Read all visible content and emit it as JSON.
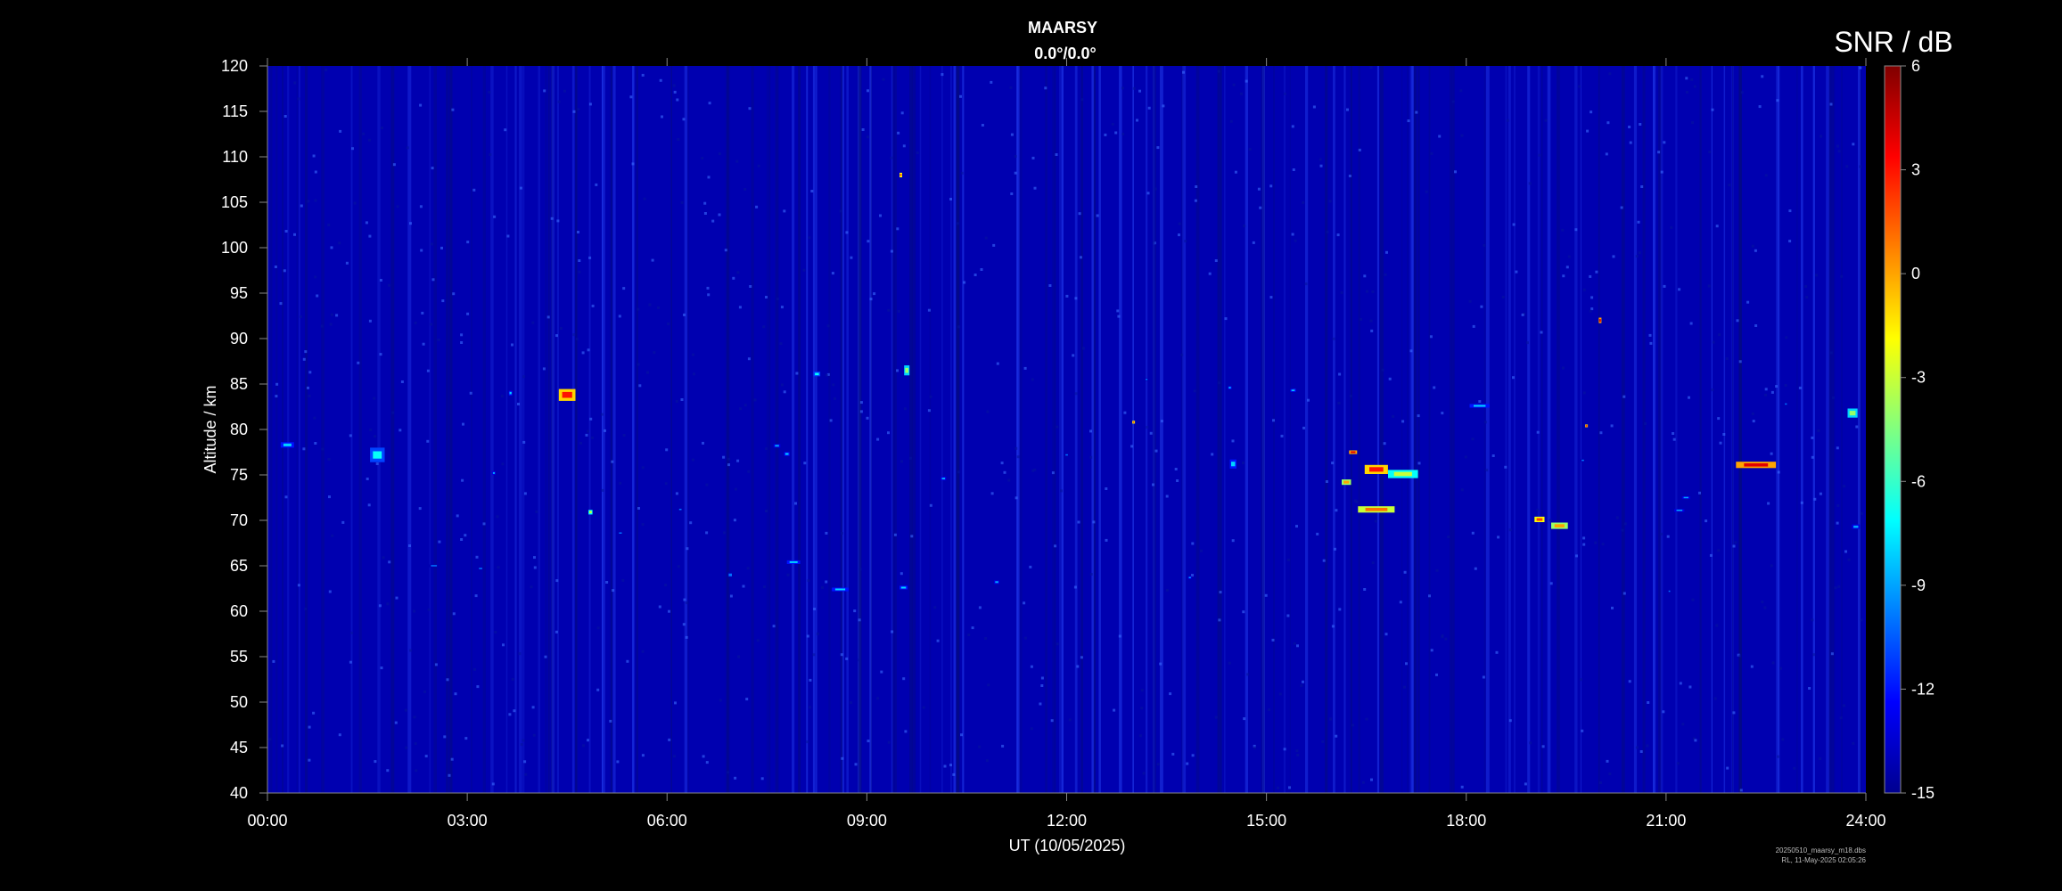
{
  "chart_data": {
    "type": "heatmap",
    "title": "MAARSY",
    "subtitle": "0.0°/0.0°",
    "xlabel": "UT (10/05/2025)",
    "ylabel": "Altitude / km",
    "x_ticks": [
      "00:00",
      "03:00",
      "06:00",
      "09:00",
      "12:00",
      "15:00",
      "18:00",
      "21:00",
      "24:00"
    ],
    "xlim_hours": [
      0,
      24
    ],
    "y_ticks": [
      40,
      45,
      50,
      55,
      60,
      65,
      70,
      75,
      80,
      85,
      90,
      95,
      100,
      105,
      110,
      115,
      120
    ],
    "ylim": [
      40,
      120
    ],
    "colorbar": {
      "title": "SNR / dB",
      "ticks": [
        6,
        3,
        0,
        -3,
        -6,
        -9,
        -12,
        -15
      ],
      "range": [
        -15,
        6
      ],
      "colormap": "jet"
    },
    "background_snr_db": -14,
    "echoes": [
      {
        "t": 0.3,
        "alt": 78.3,
        "dt": 0.2,
        "dh": 0.6,
        "snr": -8
      },
      {
        "t": 1.65,
        "alt": 77.2,
        "dt": 0.22,
        "dh": 1.6,
        "snr": -7
      },
      {
        "t": 3.65,
        "alt": 84.0,
        "dt": 0.05,
        "dh": 0.5,
        "snr": -8
      },
      {
        "t": 4.5,
        "alt": 83.8,
        "dt": 0.25,
        "dh": 1.3,
        "snr": 3
      },
      {
        "t": 4.85,
        "alt": 70.9,
        "dt": 0.06,
        "dh": 0.5,
        "snr": -3
      },
      {
        "t": 8.25,
        "alt": 86.1,
        "dt": 0.1,
        "dh": 0.5,
        "snr": -7
      },
      {
        "t": 9.6,
        "alt": 86.5,
        "dt": 0.08,
        "dh": 1.1,
        "snr": -4
      },
      {
        "t": 7.65,
        "alt": 78.2,
        "dt": 0.1,
        "dh": 0.4,
        "snr": -9
      },
      {
        "t": 7.8,
        "alt": 77.3,
        "dt": 0.08,
        "dh": 0.4,
        "snr": -8
      },
      {
        "t": 7.9,
        "alt": 65.4,
        "dt": 0.2,
        "dh": 0.4,
        "snr": -8
      },
      {
        "t": 8.6,
        "alt": 62.4,
        "dt": 0.25,
        "dh": 0.4,
        "snr": -8
      },
      {
        "t": 9.55,
        "alt": 62.6,
        "dt": 0.12,
        "dh": 0.4,
        "snr": -8
      },
      {
        "t": 10.15,
        "alt": 74.6,
        "dt": 0.08,
        "dh": 0.4,
        "snr": -9
      },
      {
        "t": 10.95,
        "alt": 63.2,
        "dt": 0.08,
        "dh": 0.4,
        "snr": -9
      },
      {
        "t": 2.5,
        "alt": 65.0,
        "dt": 0.15,
        "dh": 0.3,
        "snr": -10
      },
      {
        "t": 3.2,
        "alt": 64.7,
        "dt": 0.08,
        "dh": 0.3,
        "snr": -10
      },
      {
        "t": 3.4,
        "alt": 75.2,
        "dt": 0.05,
        "dh": 0.4,
        "snr": -9
      },
      {
        "t": 5.3,
        "alt": 68.6,
        "dt": 0.07,
        "dh": 0.3,
        "snr": -10
      },
      {
        "t": 6.2,
        "alt": 71.2,
        "dt": 0.06,
        "dh": 0.3,
        "snr": -10
      },
      {
        "t": 6.95,
        "alt": 64.0,
        "dt": 0.08,
        "dh": 0.6,
        "snr": -10
      },
      {
        "t": 14.45,
        "alt": 84.6,
        "dt": 0.05,
        "dh": 0.3,
        "snr": -8
      },
      {
        "t": 15.4,
        "alt": 84.3,
        "dt": 0.08,
        "dh": 0.3,
        "snr": -8
      },
      {
        "t": 14.5,
        "alt": 76.2,
        "dt": 0.1,
        "dh": 1.0,
        "snr": -8
      },
      {
        "t": 13.85,
        "alt": 63.7,
        "dt": 0.05,
        "dh": 0.3,
        "snr": -9
      },
      {
        "t": 13.2,
        "alt": 85.5,
        "dt": 0.05,
        "dh": 0.3,
        "snr": -10
      },
      {
        "t": 16.3,
        "alt": 77.5,
        "dt": 0.12,
        "dh": 0.4,
        "snr": 4
      },
      {
        "t": 16.2,
        "alt": 74.2,
        "dt": 0.14,
        "dh": 0.6,
        "snr": 0
      },
      {
        "t": 16.65,
        "alt": 75.6,
        "dt": 0.35,
        "dh": 1.0,
        "snr": 3
      },
      {
        "t": 17.05,
        "alt": 75.1,
        "dt": 0.45,
        "dh": 0.9,
        "snr": -3
      },
      {
        "t": 16.65,
        "alt": 71.2,
        "dt": 0.55,
        "dh": 0.7,
        "snr": 1
      },
      {
        "t": 18.2,
        "alt": 82.6,
        "dt": 0.3,
        "dh": 0.4,
        "snr": -8
      },
      {
        "t": 19.1,
        "alt": 70.1,
        "dt": 0.15,
        "dh": 0.6,
        "snr": 2
      },
      {
        "t": 19.4,
        "alt": 69.4,
        "dt": 0.25,
        "dh": 0.7,
        "snr": 0
      },
      {
        "t": 20.0,
        "alt": 92.0,
        "dt": 0.02,
        "dh": 0.6,
        "snr": 4
      },
      {
        "t": 22.35,
        "alt": 76.1,
        "dt": 0.6,
        "dh": 0.7,
        "snr": 4
      },
      {
        "t": 21.3,
        "alt": 72.5,
        "dt": 0.12,
        "dh": 0.3,
        "snr": -9
      },
      {
        "t": 21.2,
        "alt": 71.1,
        "dt": 0.15,
        "dh": 0.3,
        "snr": -9
      },
      {
        "t": 23.8,
        "alt": 81.8,
        "dt": 0.15,
        "dh": 1.0,
        "snr": -4
      },
      {
        "t": 23.85,
        "alt": 69.3,
        "dt": 0.12,
        "dh": 0.5,
        "snr": -9
      },
      {
        "t": 21.05,
        "alt": 62.2,
        "dt": 0.04,
        "dh": 0.3,
        "snr": -10
      },
      {
        "t": 12.0,
        "alt": 77.2,
        "dt": 0.06,
        "dh": 0.3,
        "snr": -10
      },
      {
        "t": 19.75,
        "alt": 76.6,
        "dt": 0.06,
        "dh": 0.3,
        "snr": -10
      },
      {
        "t": 22.8,
        "alt": 82.8,
        "dt": 0.05,
        "dh": 0.3,
        "snr": -10
      },
      {
        "t": 9.5,
        "alt": 108.0,
        "dt": 0.02,
        "dh": 0.5,
        "snr": 2
      },
      {
        "t": 13.0,
        "alt": 80.8,
        "dt": 0.03,
        "dh": 0.3,
        "snr": 2
      },
      {
        "t": 19.8,
        "alt": 80.4,
        "dt": 0.03,
        "dh": 0.3,
        "snr": 3
      }
    ]
  },
  "footer": {
    "file": "20250510_maarsy_m18.dbs",
    "stamp": "RL, 11-May-2025 02:05:26"
  }
}
